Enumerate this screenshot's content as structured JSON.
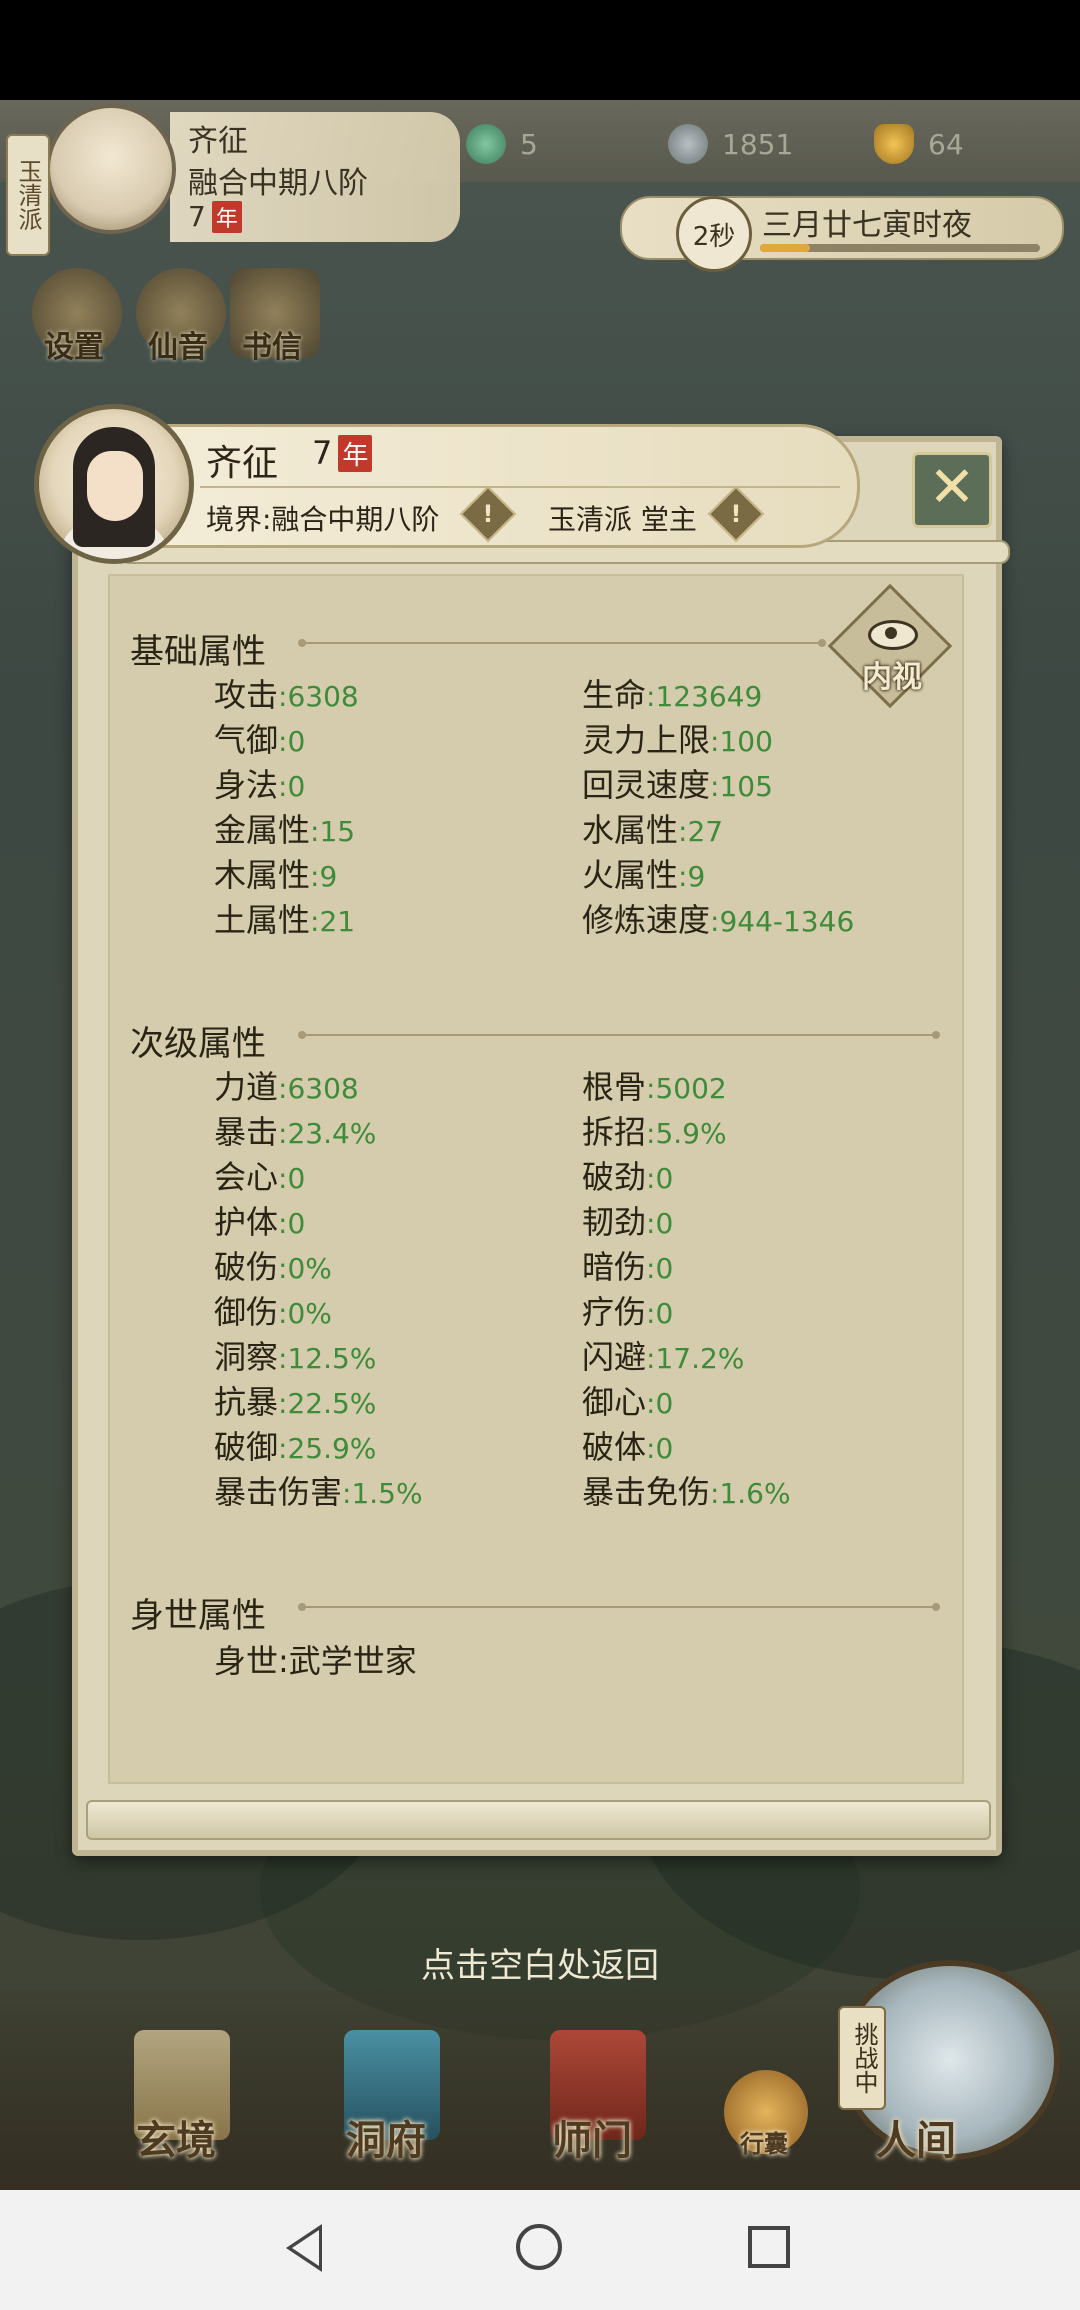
{
  "hud": {
    "sect": "玉清派",
    "name": "齐征",
    "realm": "融合中期八阶",
    "age": "7",
    "age_unit": "年",
    "resources": [
      {
        "icon": "spirit-stone-icon",
        "value": "5"
      },
      {
        "icon": "coin-icon",
        "value": "1851"
      },
      {
        "icon": "gold-ingot-icon",
        "value": "64"
      }
    ],
    "timer": "2秒",
    "time_text": "三月廿七寅时夜",
    "time_progress": 0.18,
    "buttons": [
      {
        "icon": "settings-icon",
        "label": "设置"
      },
      {
        "icon": "immortal-voice-icon",
        "label": "仙音"
      },
      {
        "icon": "letter-icon",
        "label": "书信"
      }
    ]
  },
  "dialog": {
    "name": "齐征",
    "age": "7",
    "age_unit": "年",
    "realm_label": "境界:融合中期八阶",
    "sect_label": "玉清派 堂主",
    "warn_symbol": "!",
    "close_symbol": "✕",
    "inner_view_label": "内视",
    "basic_title": "基础属性",
    "basic": [
      {
        "label": "攻击",
        "value": ":6308"
      },
      {
        "label": "生命",
        "value": ":123649"
      },
      {
        "label": "气御",
        "value": ":0"
      },
      {
        "label": "灵力上限",
        "value": ":100"
      },
      {
        "label": "身法",
        "value": ":0"
      },
      {
        "label": "回灵速度",
        "value": ":105"
      },
      {
        "label": "金属性",
        "value": ":15"
      },
      {
        "label": "水属性",
        "value": ":27"
      },
      {
        "label": "木属性",
        "value": ":9"
      },
      {
        "label": "火属性",
        "value": ":9"
      },
      {
        "label": "土属性",
        "value": ":21"
      },
      {
        "label": "修炼速度",
        "value": ":944-1346"
      }
    ],
    "secondary_title": "次级属性",
    "secondary": [
      {
        "label": "力道",
        "value": ":6308"
      },
      {
        "label": "根骨",
        "value": ":5002"
      },
      {
        "label": "暴击",
        "value": ":23.4%"
      },
      {
        "label": "拆招",
        "value": ":5.9%"
      },
      {
        "label": "会心",
        "value": ":0"
      },
      {
        "label": "破劲",
        "value": ":0"
      },
      {
        "label": "护体",
        "value": ":0"
      },
      {
        "label": "韧劲",
        "value": ":0"
      },
      {
        "label": "破伤",
        "value": ":0%"
      },
      {
        "label": "暗伤",
        "value": ":0"
      },
      {
        "label": "御伤",
        "value": ":0%"
      },
      {
        "label": "疗伤",
        "value": ":0"
      },
      {
        "label": "洞察",
        "value": ":12.5%"
      },
      {
        "label": "闪避",
        "value": ":17.2%"
      },
      {
        "label": "抗暴",
        "value": ":22.5%"
      },
      {
        "label": "御心",
        "value": ":0"
      },
      {
        "label": "破御",
        "value": ":25.9%"
      },
      {
        "label": "破体",
        "value": ":0"
      },
      {
        "label": "暴击伤害",
        "value": ":1.5%"
      },
      {
        "label": "暴击免伤",
        "value": ":1.6%"
      }
    ],
    "background_title": "身世属性",
    "background_label": "身世",
    "background_value": ":武学世家"
  },
  "return_hint": "点击空白处返回",
  "bottom_nav": {
    "items": [
      {
        "icon": "scroll-icon",
        "label": "玄境"
      },
      {
        "icon": "pavilion-icon",
        "label": "洞府"
      },
      {
        "icon": "banner-icon",
        "label": "师门"
      },
      {
        "icon": "pouch-icon",
        "label": "行囊"
      },
      {
        "icon": "mountain-icon",
        "label": "人间"
      }
    ],
    "challenge_tag": "挑战中"
  },
  "colors": {
    "value_green": "#3f8b3a",
    "text_dark": "#2a2416",
    "parchment": "#d4ccac",
    "nian_red": "#c0392b"
  }
}
